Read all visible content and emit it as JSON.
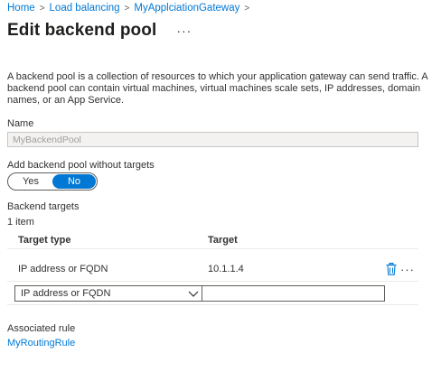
{
  "breadcrumb": {
    "items": [
      "Home",
      "Load balancing",
      "MyApplciationGateway"
    ],
    "separator": ">"
  },
  "page": {
    "title": "Edit backend pool",
    "more_glyph": "···"
  },
  "description": "A backend pool is a collection of resources to which your application gateway can send traffic. A backend pool can contain virtual machines, virtual machines scale sets, IP addresses, domain names, or an App Service.",
  "name_field": {
    "label": "Name",
    "value": "MyBackendPool"
  },
  "targets_toggle": {
    "label": "Add backend pool without targets",
    "options": [
      "Yes",
      "No"
    ],
    "selected": "No"
  },
  "backend_targets": {
    "label": "Backend targets",
    "count": "1 item",
    "columns": [
      "Target type",
      "Target"
    ],
    "rows": [
      {
        "type": "IP address or FQDN",
        "target": "10.1.1.4"
      }
    ],
    "new_row": {
      "type_selected": "IP address or FQDN",
      "target_value": ""
    },
    "row_more_glyph": "···"
  },
  "associated_rule": {
    "label": "Associated rule",
    "link": "MyRoutingRule"
  },
  "colors": {
    "accent": "#0078d4",
    "text": "#323130",
    "disabled_bg": "#f3f2f1",
    "border": "#c8c6c4"
  },
  "icons": {
    "breadcrumb_separator": "chevron-right-icon",
    "delete": "trash-icon",
    "dropdown": "chevron-down-icon"
  }
}
